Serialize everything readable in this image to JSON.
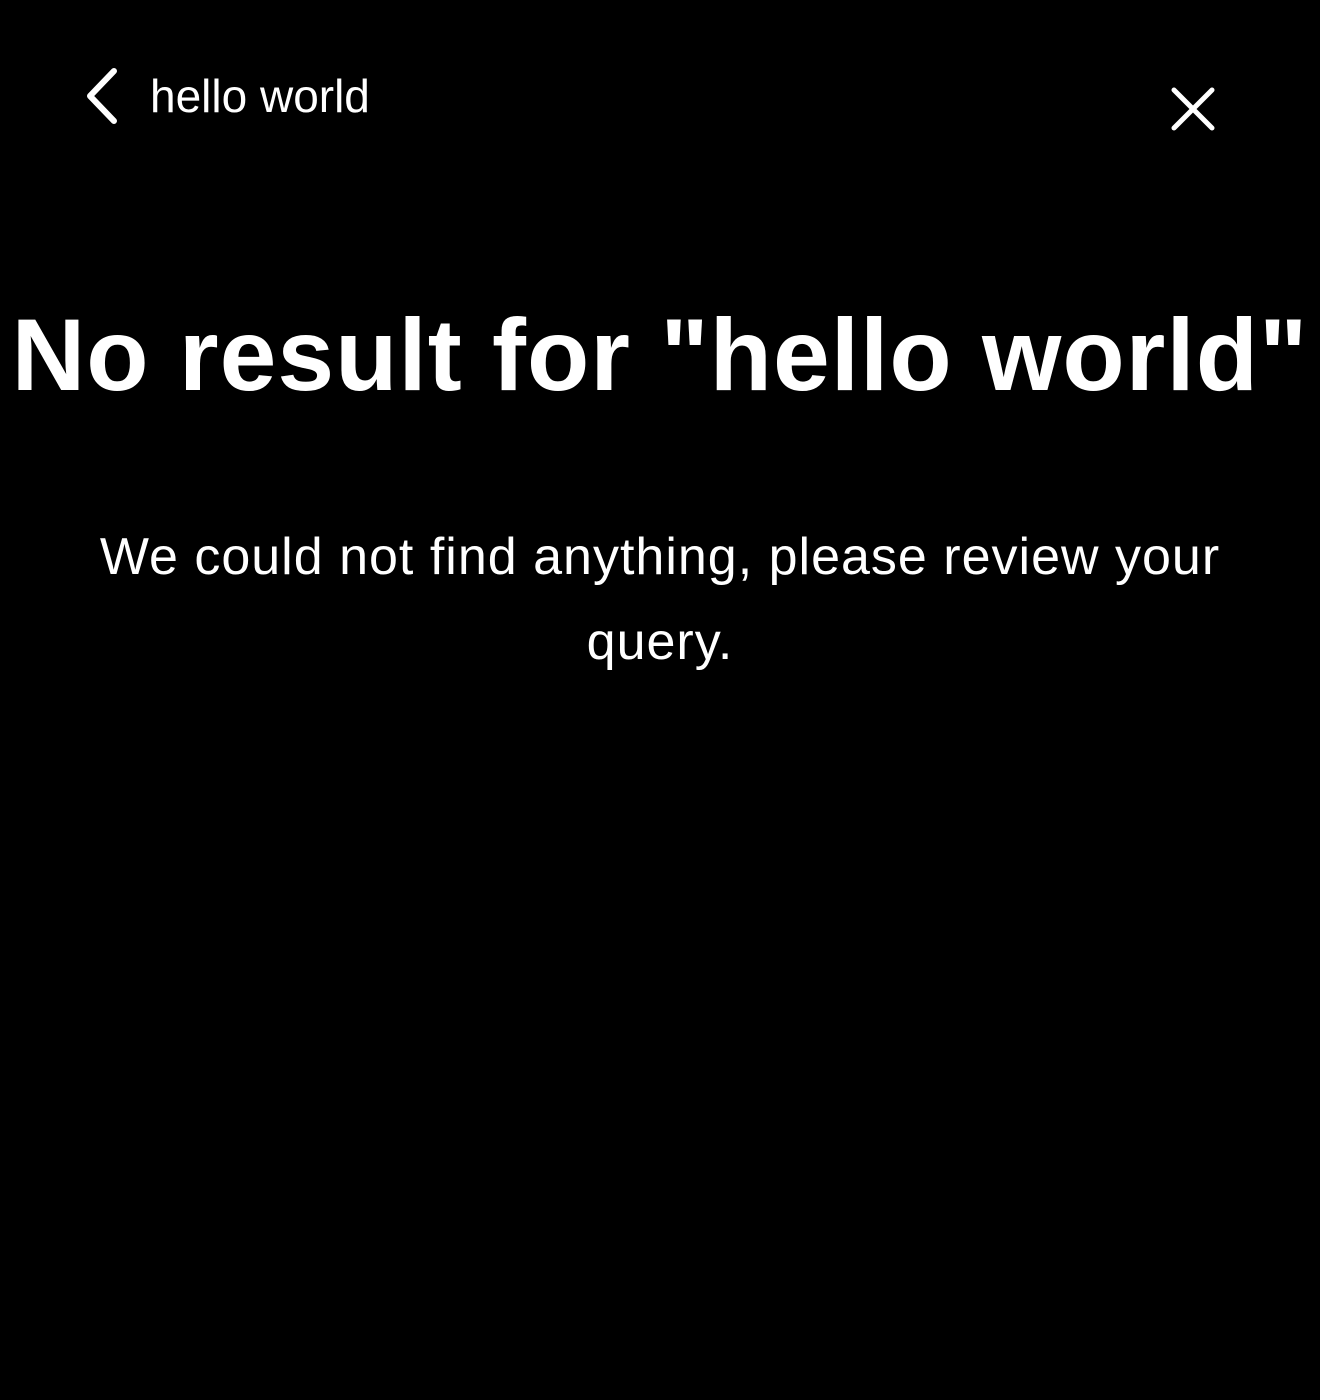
{
  "header": {
    "back_icon": "chevron-left-icon",
    "query": "hello world",
    "close_icon": "close-icon"
  },
  "empty_state": {
    "title": "No result for \"hello world\"",
    "message": "We could not find anything, please review your query."
  },
  "colors": {
    "background": "#000000",
    "text": "#ffffff"
  }
}
